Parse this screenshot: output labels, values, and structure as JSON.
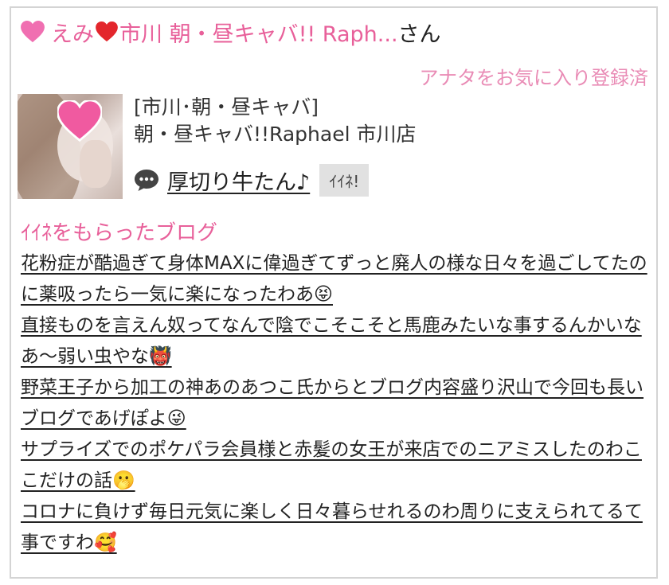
{
  "header": {
    "name": "えみ",
    "shop_short": "市川 朝・昼キャバ!! Raph...",
    "suffix": "さん",
    "heart_color": "#f06fb1",
    "red_heart_color": "#e3262c"
  },
  "favorite_status": "アナタをお気に入り登録済",
  "profile": {
    "area": "[市川･朝・昼キャバ]",
    "shop_name": "朝・昼キャバ!!Raphael 市川店",
    "message": "厚切り牛たん♪",
    "iine_button": "ｲｲﾈ!"
  },
  "blog_section_title": "ｲｲﾈをもらったブログ",
  "blogs": [
    {
      "title": "花粉症が酷過ぎて身体MAXに偉過ぎてずっと廃人の様な日々を過ごしてたのに薬吸ったら一気に楽になったわあ😝"
    },
    {
      "title": "直接ものを言えん奴ってなんで陰でこそこそと馬鹿みたいな事するんかいなあ～弱い虫やな👹"
    },
    {
      "title": "野菜王子から加工の神あのあつこ氏からとブログ内容盛り沢山で今回も長いブログであげぽよ😜"
    },
    {
      "title": "サプライズでのポケパラ会員様と赤髪の女王が来店でのニアミスしたのわここだけの話🫢"
    },
    {
      "title": "コロナに負けず毎日元気に楽しく日々暮らせれるのわ周りに支えられてるて事ですわ🥰"
    }
  ],
  "colors": {
    "accent_pink": "#e8609a",
    "light_pink": "#e98bb5",
    "border": "#d4d4d4",
    "button_bg": "#e1e1e1"
  }
}
